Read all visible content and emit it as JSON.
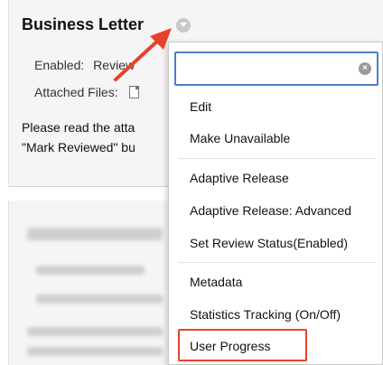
{
  "item": {
    "title": "Business Letter",
    "enabled_label": "Enabled:",
    "enabled_value": "Review",
    "files_label": "Attached Files:",
    "description": "Please read the attached ... \"Mark Reviewed\" bu..."
  },
  "menu": {
    "search_placeholder": "",
    "items": [
      "Edit",
      "Make Unavailable",
      "Adaptive Release",
      "Adaptive Release: Advanced",
      "Set Review Status(Enabled)",
      "Metadata",
      "Statistics Tracking (On/Off)",
      "User Progress"
    ]
  },
  "colors": {
    "accent_focus": "#4a7fc6",
    "annotation_red": "#e8412b"
  }
}
